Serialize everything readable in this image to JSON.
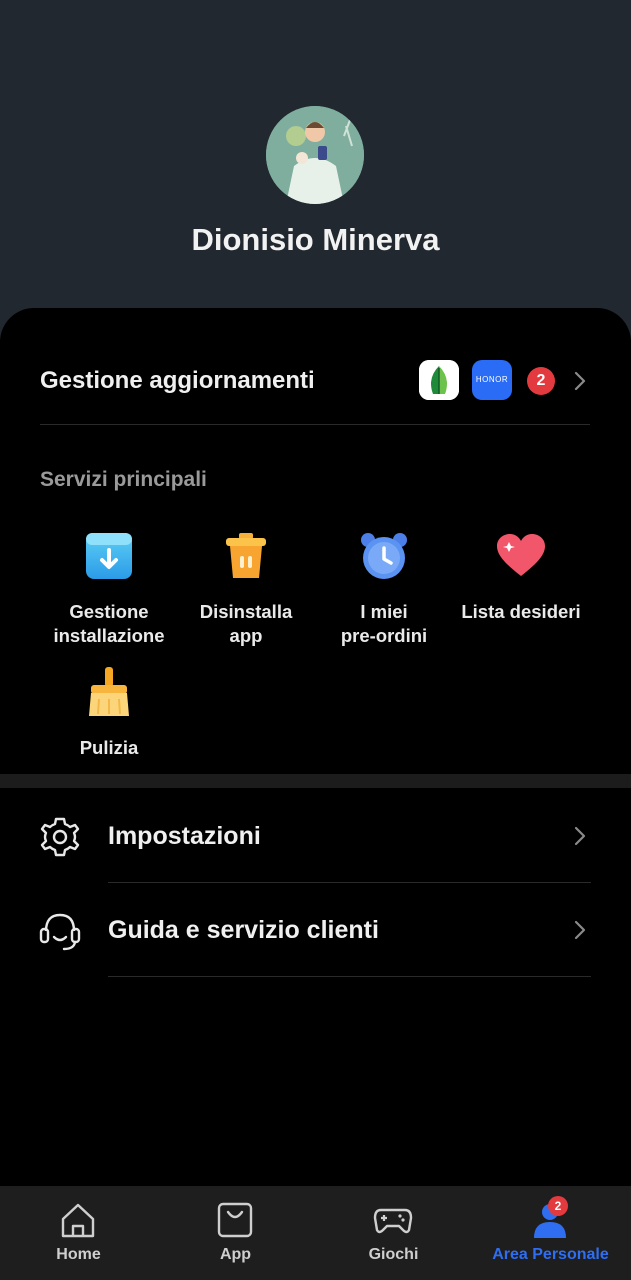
{
  "profile": {
    "name": "Dionisio Minerva"
  },
  "updates": {
    "title": "Gestione aggiornamenti",
    "app_b_label": "HONOR",
    "count": "2"
  },
  "services": {
    "section_label": "Servizi principali",
    "items": [
      {
        "label": "Gestione\ninstallazione",
        "icon": "download-box-icon"
      },
      {
        "label": "Disinstalla\napp",
        "icon": "trash-icon"
      },
      {
        "label": "I miei\npre-ordini",
        "icon": "alarm-clock-icon"
      },
      {
        "label": "Lista desideri",
        "icon": "heart-icon"
      },
      {
        "label": "Pulizia",
        "icon": "broom-icon"
      }
    ]
  },
  "menu": [
    {
      "label": "Impostazioni",
      "icon": "gear-icon"
    },
    {
      "label": "Guida e servizio clienti",
      "icon": "headset-icon"
    }
  ],
  "tabs": [
    {
      "label": "Home",
      "icon": "home-icon"
    },
    {
      "label": "App",
      "icon": "shopping-bag-icon"
    },
    {
      "label": "Giochi",
      "icon": "gamepad-icon"
    },
    {
      "label": "Area Personale",
      "icon": "person-icon",
      "badge": "2",
      "active": true
    }
  ],
  "colors": {
    "accent": "#2f6ef0",
    "badge": "#e33a3f",
    "header_bg": "#222830"
  }
}
